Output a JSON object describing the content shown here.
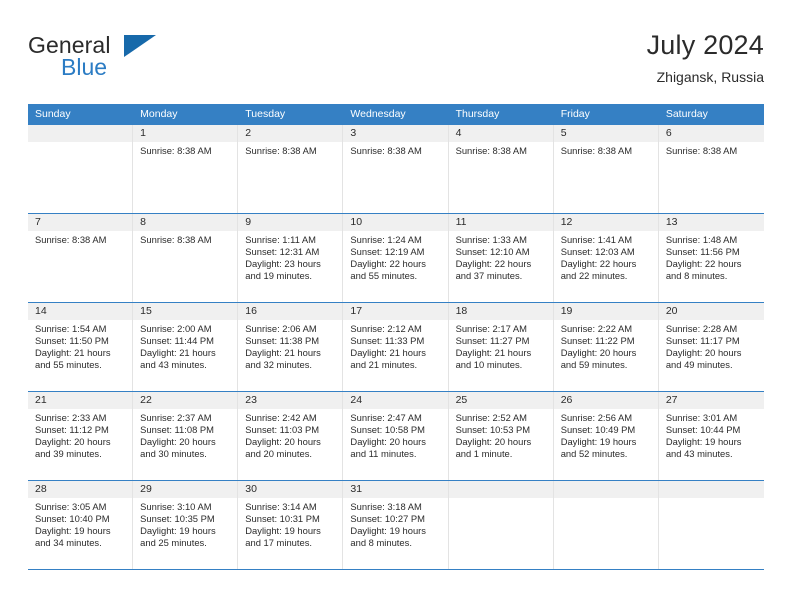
{
  "logo": {
    "word_general": "General",
    "word_blue": "Blue",
    "triangle_color": "#1769aa",
    "blue_color": "#2b7cc4"
  },
  "header": {
    "title": "July 2024",
    "subtitle": "Zhigansk, Russia"
  },
  "theme": {
    "header_band": "#3580c4",
    "daynum_band": "#f0f0f0",
    "text": "#2b2b2b",
    "cell_border": "#e3e3e3"
  },
  "weekdays": [
    "Sunday",
    "Monday",
    "Tuesday",
    "Wednesday",
    "Thursday",
    "Friday",
    "Saturday"
  ],
  "weeks": [
    [
      {
        "day": "",
        "lines": []
      },
      {
        "day": "1",
        "lines": [
          "Sunrise: 8:38 AM"
        ]
      },
      {
        "day": "2",
        "lines": [
          "Sunrise: 8:38 AM"
        ]
      },
      {
        "day": "3",
        "lines": [
          "Sunrise: 8:38 AM"
        ]
      },
      {
        "day": "4",
        "lines": [
          "Sunrise: 8:38 AM"
        ]
      },
      {
        "day": "5",
        "lines": [
          "Sunrise: 8:38 AM"
        ]
      },
      {
        "day": "6",
        "lines": [
          "Sunrise: 8:38 AM"
        ]
      }
    ],
    [
      {
        "day": "7",
        "lines": [
          "Sunrise: 8:38 AM"
        ]
      },
      {
        "day": "8",
        "lines": [
          "Sunrise: 8:38 AM"
        ]
      },
      {
        "day": "9",
        "lines": [
          "Sunrise: 1:11 AM",
          "Sunset: 12:31 AM",
          "Daylight: 23 hours",
          "and 19 minutes."
        ]
      },
      {
        "day": "10",
        "lines": [
          "Sunrise: 1:24 AM",
          "Sunset: 12:19 AM",
          "Daylight: 22 hours",
          "and 55 minutes."
        ]
      },
      {
        "day": "11",
        "lines": [
          "Sunrise: 1:33 AM",
          "Sunset: 12:10 AM",
          "Daylight: 22 hours",
          "and 37 minutes."
        ]
      },
      {
        "day": "12",
        "lines": [
          "Sunrise: 1:41 AM",
          "Sunset: 12:03 AM",
          "Daylight: 22 hours",
          "and 22 minutes."
        ]
      },
      {
        "day": "13",
        "lines": [
          "Sunrise: 1:48 AM",
          "Sunset: 11:56 PM",
          "Daylight: 22 hours",
          "and 8 minutes."
        ]
      }
    ],
    [
      {
        "day": "14",
        "lines": [
          "Sunrise: 1:54 AM",
          "Sunset: 11:50 PM",
          "Daylight: 21 hours",
          "and 55 minutes."
        ]
      },
      {
        "day": "15",
        "lines": [
          "Sunrise: 2:00 AM",
          "Sunset: 11:44 PM",
          "Daylight: 21 hours",
          "and 43 minutes."
        ]
      },
      {
        "day": "16",
        "lines": [
          "Sunrise: 2:06 AM",
          "Sunset: 11:38 PM",
          "Daylight: 21 hours",
          "and 32 minutes."
        ]
      },
      {
        "day": "17",
        "lines": [
          "Sunrise: 2:12 AM",
          "Sunset: 11:33 PM",
          "Daylight: 21 hours",
          "and 21 minutes."
        ]
      },
      {
        "day": "18",
        "lines": [
          "Sunrise: 2:17 AM",
          "Sunset: 11:27 PM",
          "Daylight: 21 hours",
          "and 10 minutes."
        ]
      },
      {
        "day": "19",
        "lines": [
          "Sunrise: 2:22 AM",
          "Sunset: 11:22 PM",
          "Daylight: 20 hours",
          "and 59 minutes."
        ]
      },
      {
        "day": "20",
        "lines": [
          "Sunrise: 2:28 AM",
          "Sunset: 11:17 PM",
          "Daylight: 20 hours",
          "and 49 minutes."
        ]
      }
    ],
    [
      {
        "day": "21",
        "lines": [
          "Sunrise: 2:33 AM",
          "Sunset: 11:12 PM",
          "Daylight: 20 hours",
          "and 39 minutes."
        ]
      },
      {
        "day": "22",
        "lines": [
          "Sunrise: 2:37 AM",
          "Sunset: 11:08 PM",
          "Daylight: 20 hours",
          "and 30 minutes."
        ]
      },
      {
        "day": "23",
        "lines": [
          "Sunrise: 2:42 AM",
          "Sunset: 11:03 PM",
          "Daylight: 20 hours",
          "and 20 minutes."
        ]
      },
      {
        "day": "24",
        "lines": [
          "Sunrise: 2:47 AM",
          "Sunset: 10:58 PM",
          "Daylight: 20 hours",
          "and 11 minutes."
        ]
      },
      {
        "day": "25",
        "lines": [
          "Sunrise: 2:52 AM",
          "Sunset: 10:53 PM",
          "Daylight: 20 hours",
          "and 1 minute."
        ]
      },
      {
        "day": "26",
        "lines": [
          "Sunrise: 2:56 AM",
          "Sunset: 10:49 PM",
          "Daylight: 19 hours",
          "and 52 minutes."
        ]
      },
      {
        "day": "27",
        "lines": [
          "Sunrise: 3:01 AM",
          "Sunset: 10:44 PM",
          "Daylight: 19 hours",
          "and 43 minutes."
        ]
      }
    ],
    [
      {
        "day": "28",
        "lines": [
          "Sunrise: 3:05 AM",
          "Sunset: 10:40 PM",
          "Daylight: 19 hours",
          "and 34 minutes."
        ]
      },
      {
        "day": "29",
        "lines": [
          "Sunrise: 3:10 AM",
          "Sunset: 10:35 PM",
          "Daylight: 19 hours",
          "and 25 minutes."
        ]
      },
      {
        "day": "30",
        "lines": [
          "Sunrise: 3:14 AM",
          "Sunset: 10:31 PM",
          "Daylight: 19 hours",
          "and 17 minutes."
        ]
      },
      {
        "day": "31",
        "lines": [
          "Sunrise: 3:18 AM",
          "Sunset: 10:27 PM",
          "Daylight: 19 hours",
          "and 8 minutes."
        ]
      },
      {
        "day": "",
        "lines": []
      },
      {
        "day": "",
        "lines": []
      },
      {
        "day": "",
        "lines": []
      }
    ]
  ]
}
